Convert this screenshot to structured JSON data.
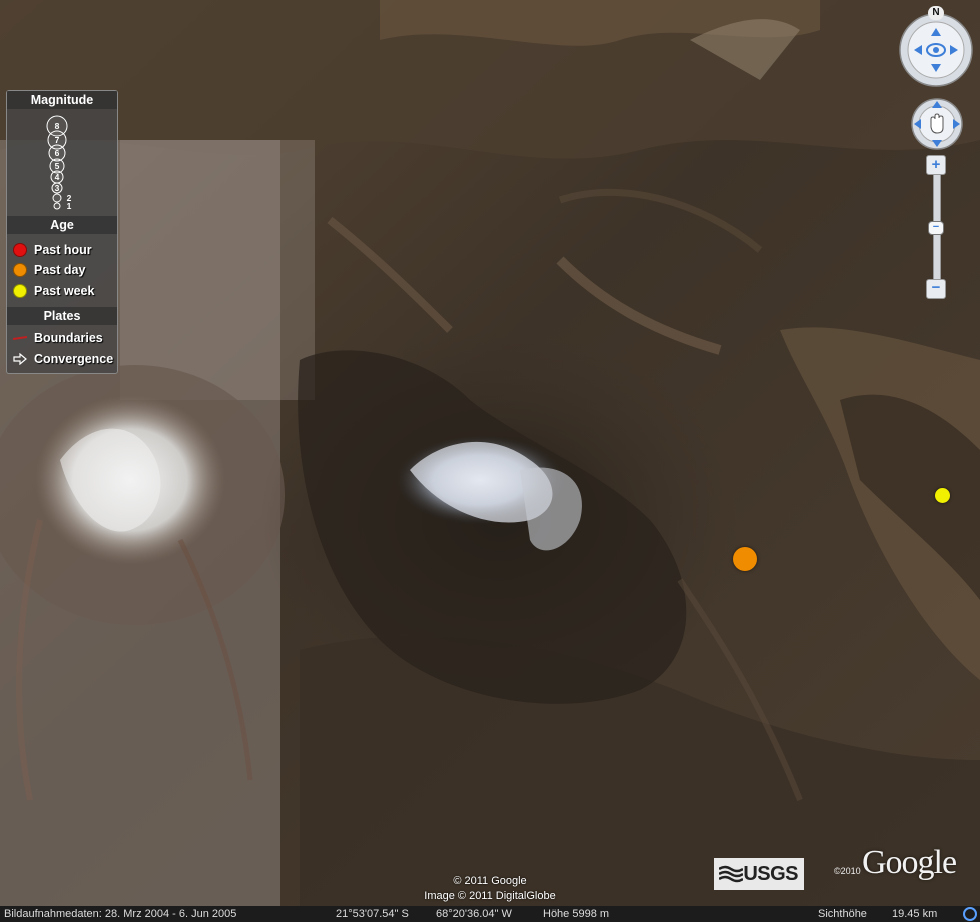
{
  "legend": {
    "magnitude_title": "Magnitude",
    "magnitude_values": [
      "8",
      "7",
      "6",
      "5",
      "4",
      "3",
      "2",
      "1"
    ],
    "age_title": "Age",
    "age_items": [
      {
        "label": "Past hour",
        "color": "#e01010"
      },
      {
        "label": "Past day",
        "color": "#f08c00"
      },
      {
        "label": "Past week",
        "color": "#f0f000"
      }
    ],
    "plates_title": "Plates",
    "plates_items": [
      {
        "label": "Boundaries",
        "icon": "red-line-icon",
        "color": "#c02020"
      },
      {
        "label": "Convergence",
        "icon": "arrow-right-icon"
      }
    ]
  },
  "markers": [
    {
      "age": "Past day",
      "color": "#f08c00"
    },
    {
      "age": "Past week",
      "color": "#f0f000"
    }
  ],
  "nav": {
    "north_label": "N",
    "zoom_in": "+",
    "zoom_out": "−"
  },
  "attribution": {
    "copyright_google": "© 2011 Google",
    "copyright_image": "Image © 2011 DigitalGlobe",
    "usgs": "USGS",
    "google_logo": "Google",
    "google_year": "©2010"
  },
  "status_bar": {
    "image_dates": "Bildaufnahmedaten: 28. Mrz 2004 - 6. Jun 2005",
    "latitude": "21°53'07.54\" S",
    "longitude": "68°20'36.04\" W",
    "elevation": "Höhe 5998 m",
    "eye_alt_label": "Sichthöhe",
    "eye_alt_value": "19.45 km"
  }
}
